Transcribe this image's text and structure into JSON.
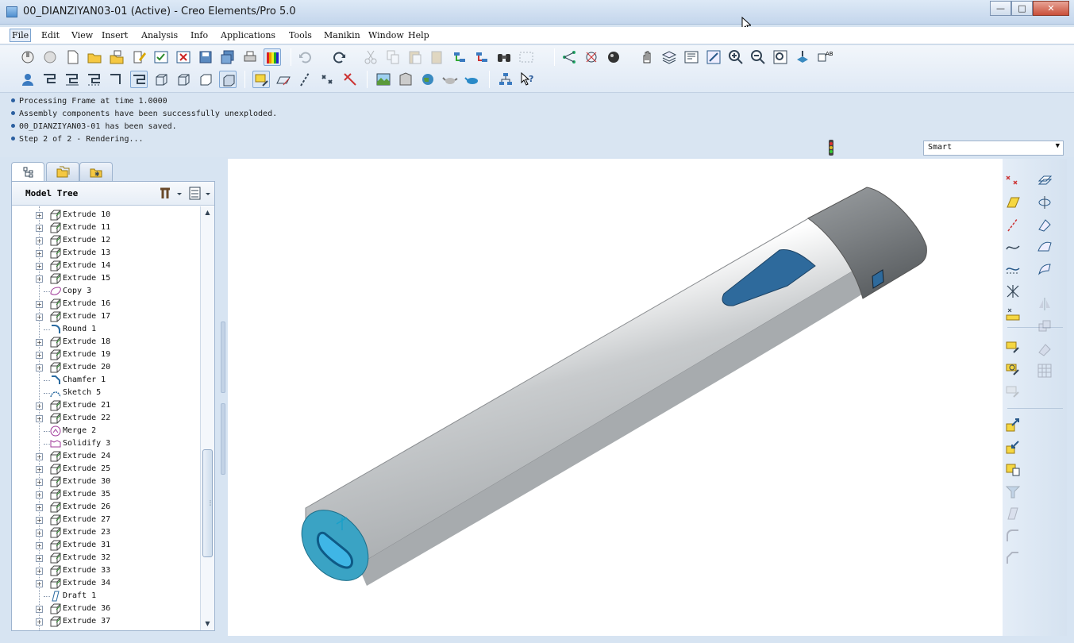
{
  "window": {
    "title": "00_DIANZIYAN03-01 (Active) - Creo Elements/Pro 5.0",
    "minimize_label": "—",
    "maximize_label": "□",
    "close_label": "✕"
  },
  "menu": [
    {
      "label": "File",
      "active": true
    },
    {
      "label": "Edit"
    },
    {
      "label": "View"
    },
    {
      "label": "Insert"
    },
    {
      "label": "Analysis"
    },
    {
      "label": "Info"
    },
    {
      "label": "Applications"
    },
    {
      "label": "Tools"
    },
    {
      "label": "Manikin"
    },
    {
      "label": "Window"
    },
    {
      "label": "Help"
    }
  ],
  "messages": [
    "Processing Frame at time 1.0000",
    "Assembly components have been successfully unexploded.",
    "00_DIANZIYAN03-01 has been saved.",
    "Step 2 of 2 - Rendering..."
  ],
  "filter": {
    "value": "Smart",
    "arrow": "▼"
  },
  "model_tree": {
    "title": "Model Tree",
    "items": [
      {
        "label": "Extrude 10",
        "icon": "extrude-icon",
        "expandable": true
      },
      {
        "label": "Extrude 11",
        "icon": "extrude-icon",
        "expandable": true
      },
      {
        "label": "Extrude 12",
        "icon": "extrude-icon",
        "expandable": true
      },
      {
        "label": "Extrude 13",
        "icon": "extrude-icon",
        "expandable": true
      },
      {
        "label": "Extrude 14",
        "icon": "extrude-icon",
        "expandable": true
      },
      {
        "label": "Extrude 15",
        "icon": "extrude-icon",
        "expandable": true
      },
      {
        "label": "Copy 3",
        "icon": "copy-icon",
        "expandable": false
      },
      {
        "label": "Extrude 16",
        "icon": "extrude-icon",
        "expandable": true
      },
      {
        "label": "Extrude 17",
        "icon": "extrude-icon",
        "expandable": true
      },
      {
        "label": "Round 1",
        "icon": "round-icon",
        "expandable": false
      },
      {
        "label": "Extrude 18",
        "icon": "extrude-icon",
        "expandable": true
      },
      {
        "label": "Extrude 19",
        "icon": "extrude-icon",
        "expandable": true
      },
      {
        "label": "Extrude 20",
        "icon": "extrude-icon",
        "expandable": true
      },
      {
        "label": "Chamfer 1",
        "icon": "chamfer-icon",
        "expandable": false
      },
      {
        "label": "Sketch 5",
        "icon": "sketch-icon",
        "expandable": false
      },
      {
        "label": "Extrude 21",
        "icon": "extrude-icon",
        "expandable": true
      },
      {
        "label": "Extrude 22",
        "icon": "extrude-icon",
        "expandable": true
      },
      {
        "label": "Merge 2",
        "icon": "merge-icon",
        "expandable": false
      },
      {
        "label": "Solidify 3",
        "icon": "solidify-icon",
        "expandable": false
      },
      {
        "label": "Extrude 24",
        "icon": "extrude-icon",
        "expandable": true
      },
      {
        "label": "Extrude 25",
        "icon": "extrude-icon",
        "expandable": true
      },
      {
        "label": "Extrude 30",
        "icon": "extrude-icon",
        "expandable": true
      },
      {
        "label": "Extrude 35",
        "icon": "extrude-icon",
        "expandable": true
      },
      {
        "label": "Extrude 26",
        "icon": "extrude-icon",
        "expandable": true
      },
      {
        "label": "Extrude 27",
        "icon": "extrude-icon",
        "expandable": true
      },
      {
        "label": "Extrude 23",
        "icon": "extrude-icon",
        "expandable": true
      },
      {
        "label": "Extrude 31",
        "icon": "extrude-icon",
        "expandable": true
      },
      {
        "label": "Extrude 32",
        "icon": "extrude-icon",
        "expandable": true
      },
      {
        "label": "Extrude 33",
        "icon": "extrude-icon",
        "expandable": true
      },
      {
        "label": "Extrude 34",
        "icon": "extrude-icon",
        "expandable": true
      },
      {
        "label": "Draft 1",
        "icon": "draft-icon",
        "expandable": false
      },
      {
        "label": "Extrude 36",
        "icon": "extrude-icon",
        "expandable": true
      },
      {
        "label": "Extrude 37",
        "icon": "extrude-icon",
        "expandable": true
      }
    ]
  },
  "colors": {
    "model_body": "#c9ccce",
    "model_cap": "#7d8184",
    "model_window": "#2e6a9c",
    "highlight": "#38a7c8"
  }
}
